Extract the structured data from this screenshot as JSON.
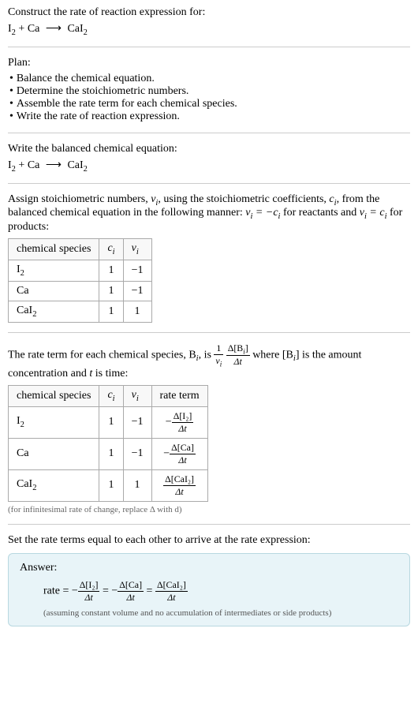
{
  "prompt": {
    "title": "Construct the rate of reaction expression for:",
    "equation_parts": {
      "reactants": "I₂ + Ca",
      "arrow": "⟶",
      "products": "CaI₂"
    }
  },
  "plan": {
    "title": "Plan:",
    "items": [
      "Balance the chemical equation.",
      "Determine the stoichiometric numbers.",
      "Assemble the rate term for each chemical species.",
      "Write the rate of reaction expression."
    ]
  },
  "balanced": {
    "title": "Write the balanced chemical equation:",
    "equation_parts": {
      "reactants": "I₂ + Ca",
      "arrow": "⟶",
      "products": "CaI₂"
    }
  },
  "stoich": {
    "intro_1": "Assign stoichiometric numbers, ",
    "nu_i": "ν",
    "nu_sub": "i",
    "intro_2": ", using the stoichiometric coefficients, ",
    "c_i": "c",
    "c_sub": "i",
    "intro_3": ", from the balanced chemical equation in the following manner: ",
    "eq1": "ν",
    "eq1_sub": "i",
    "eq1_mid": " = −",
    "eq1_c": "c",
    "eq1_csub": "i",
    "intro_4": " for reactants and ",
    "eq2": "ν",
    "eq2_sub": "i",
    "eq2_mid": " = ",
    "eq2_c": "c",
    "eq2_csub": "i",
    "intro_5": " for products:",
    "headers": {
      "species": "chemical species",
      "ci": "c",
      "ci_sub": "i",
      "nui": "ν",
      "nui_sub": "i"
    },
    "rows": [
      {
        "species": "I₂",
        "ci": "1",
        "nui": "−1"
      },
      {
        "species": "Ca",
        "ci": "1",
        "nui": "−1"
      },
      {
        "species": "CaI₂",
        "ci": "1",
        "nui": "1"
      }
    ]
  },
  "rateterm": {
    "intro_1": "The rate term for each chemical species, B",
    "intro_1_sub": "i",
    "intro_2": ", is ",
    "frac1_num": "1",
    "frac1_den_nu": "ν",
    "frac1_den_sub": "i",
    "frac2_num": "Δ[B",
    "frac2_num_sub": "i",
    "frac2_num_close": "]",
    "frac2_den": "Δt",
    "intro_3": " where [B",
    "intro_3_sub": "i",
    "intro_4": "] is the amount concentration and ",
    "t_var": "t",
    "intro_5": " is time:",
    "headers": {
      "species": "chemical species",
      "ci": "c",
      "ci_sub": "i",
      "nui": "ν",
      "nui_sub": "i",
      "rate": "rate term"
    },
    "rows": [
      {
        "species": "I₂",
        "ci": "1",
        "nui": "−1",
        "num": "Δ[I₂]",
        "den": "Δt",
        "neg": "−"
      },
      {
        "species": "Ca",
        "ci": "1",
        "nui": "−1",
        "num": "Δ[Ca]",
        "den": "Δt",
        "neg": "−"
      },
      {
        "species": "CaI₂",
        "ci": "1",
        "nui": "1",
        "num": "Δ[CaI₂]",
        "den": "Δt",
        "neg": ""
      }
    ],
    "note": "(for infinitesimal rate of change, replace Δ with d)"
  },
  "final": {
    "title": "Set the rate terms equal to each other to arrive at the rate expression:"
  },
  "answer": {
    "title": "Answer:",
    "label": "rate = ",
    "neg1": "−",
    "num1": "Δ[I₂]",
    "den1": "Δt",
    "eq1": " = ",
    "neg2": "−",
    "num2": "Δ[Ca]",
    "den2": "Δt",
    "eq2": " = ",
    "num3": "Δ[CaI₂]",
    "den3": "Δt",
    "note": "(assuming constant volume and no accumulation of intermediates or side products)"
  }
}
